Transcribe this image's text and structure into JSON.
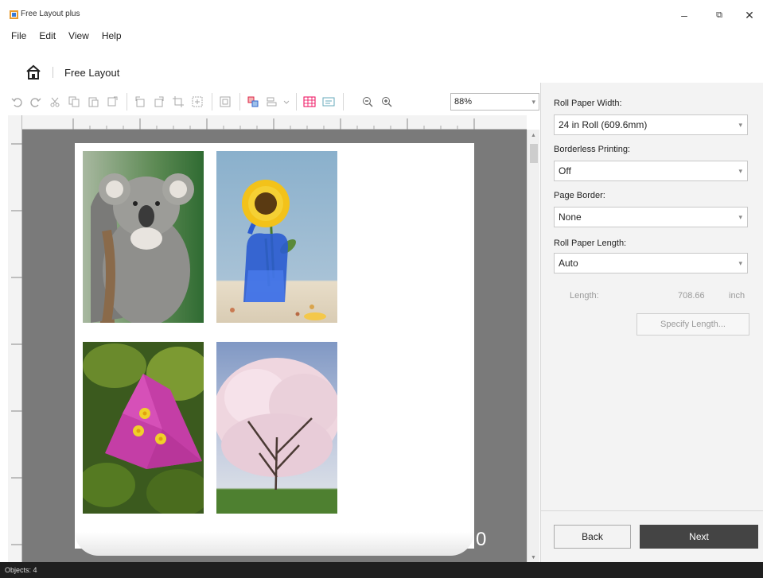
{
  "window": {
    "title": "Free Layout plus",
    "minimize_glyph": "–",
    "restore_glyph": "⧉",
    "close_glyph": "✕"
  },
  "menu": {
    "file": "File",
    "edit": "Edit",
    "view": "View",
    "help": "Help"
  },
  "breadcrumb": {
    "current": "Free Layout"
  },
  "toolbar": {
    "icons": [
      "undo-icon",
      "redo-icon",
      "cut-icon",
      "copy-icon",
      "paste-icon",
      "insert-icon",
      "rotate-left-icon",
      "rotate-right-icon",
      "crop-icon",
      "fit-icon",
      "frame-icon",
      "arrange-icon",
      "align-icon",
      "grid-icon",
      "text-icon",
      "zoom-out-icon",
      "zoom-in-icon"
    ],
    "zoom": "88%"
  },
  "canvas": {
    "photos": [
      {
        "name": "koala-photo",
        "subject": "koala"
      },
      {
        "name": "sunflower-photo",
        "subject": "sunflower"
      },
      {
        "name": "bougainvillea-photo",
        "subject": "bougainvillea"
      },
      {
        "name": "cherry-tree-photo",
        "subject": "cherry-tree"
      }
    ]
  },
  "panel": {
    "roll_width_label": "Roll Paper Width:",
    "roll_width_value": "24 in Roll (609.6mm)",
    "borderless_label": "Borderless Printing:",
    "borderless_value": "Off",
    "page_border_label": "Page Border:",
    "page_border_value": "None",
    "roll_length_label": "Roll Paper Length:",
    "roll_length_value": "Auto",
    "length_label": "Length:",
    "length_value": "708.66",
    "length_unit": "inch",
    "specify_length": "Specify Length...",
    "back": "Back",
    "next": "Next"
  },
  "status": {
    "objects": "Objects: 4"
  },
  "colors": {
    "canvas_bg": "#7a7a7a",
    "panel_bg": "#f3f3f3",
    "next_button": "#444444",
    "status_bg": "#1f1f1f"
  }
}
